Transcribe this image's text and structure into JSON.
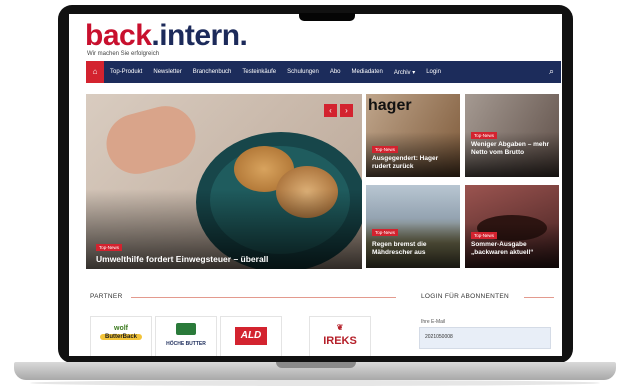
{
  "site": {
    "logo_part1": "back",
    "logo_part2": ".intern.",
    "tagline": "Wir machen Sie erfolgreich"
  },
  "nav": {
    "items": [
      "Top-Produkt",
      "Newsletter",
      "Branchenbuch",
      "Testeinkäufe",
      "Schulungen",
      "Abo",
      "Mediadaten",
      "Archiv ▾",
      "Login"
    ]
  },
  "hero": {
    "badge": "Top-News",
    "title": "Umwelthilfe fordert Einwegsteuer – überall",
    "prev_arrow": "‹",
    "next_arrow": "›"
  },
  "cards": [
    {
      "badge": "Top-News",
      "title": "Ausgegendert: Hager rudert zurück",
      "image_text": "hager"
    },
    {
      "badge": "Top-News",
      "title": "Weniger Abgaben – mehr Netto vom Brutto"
    },
    {
      "badge": "Top-News",
      "title": "Regen bremst die Mähdrescher aus"
    },
    {
      "badge": "Top-News",
      "title": "Sommer-Ausgabe „backwaren aktuell“"
    }
  ],
  "sections": {
    "partner_title": "PARTNER",
    "login_title": "LOGIN FÜR ABONNENTEN"
  },
  "partners": {
    "p1_top": "wolf",
    "p1_bottom": "ButterBack",
    "p2": "HÖCHE BUTTER",
    "p3": "ALD",
    "p4": "IREKS"
  },
  "login": {
    "email_label": "Ihre E-Mail",
    "email_value": "2021050008"
  },
  "colors": {
    "accent_red": "#d3232f",
    "nav_blue": "#1c2c5b"
  }
}
